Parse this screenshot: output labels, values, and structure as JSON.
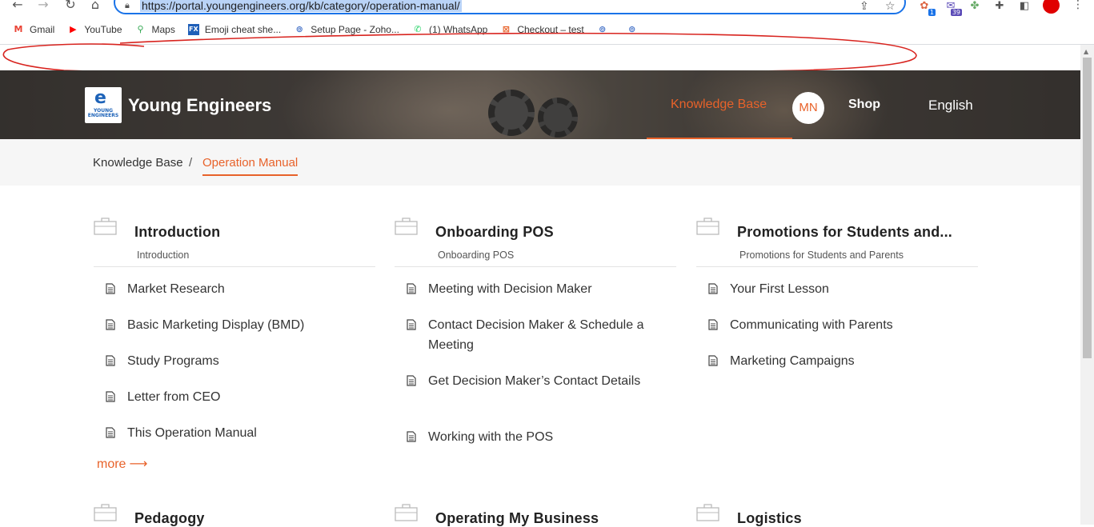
{
  "browser": {
    "url": "https://portal.youngengineers.org/kb/category/operation-manual/",
    "bookmarks": [
      {
        "label": "Gmail",
        "icon": "gmail-icon",
        "color": "#ea4335"
      },
      {
        "label": "YouTube",
        "icon": "youtube-icon",
        "color": "#ff0000"
      },
      {
        "label": "Maps",
        "icon": "maps-icon",
        "color": "#34a853"
      },
      {
        "label": "Emoji cheat she...",
        "icon": "fx-icon",
        "color": "#1f5fb8"
      },
      {
        "label": "Setup Page - Zoho...",
        "icon": "zoho-icon",
        "color": "#4a76c9"
      },
      {
        "label": "(1) WhatsApp",
        "icon": "whatsapp-icon",
        "color": "#25d366"
      },
      {
        "label": "Checkout – test",
        "icon": "checkout-icon",
        "color": "#e8622a"
      },
      {
        "label": "",
        "icon": "link-icon",
        "color": "#4a76c9"
      },
      {
        "label": "",
        "icon": "link-icon",
        "color": "#4a76c9"
      }
    ],
    "extension_badges": [
      "1",
      "39"
    ]
  },
  "header": {
    "brand": "Young Engineers",
    "logo_text": "YOUNG ENGINEERS",
    "nav": {
      "knowledge_base": "Knowledge Base",
      "user_initials": "MN",
      "shop": "Shop",
      "language": "English"
    },
    "accent_color": "#e8622a"
  },
  "breadcrumb": {
    "home": "Knowledge Base",
    "separator": "/",
    "current": "Operation Manual"
  },
  "categories": [
    {
      "title": "Introduction",
      "subtitle": "Introduction",
      "articles": [
        "Market Research",
        "Basic Marketing Display (BMD)",
        "Study Programs",
        "Letter from CEO",
        "This Operation Manual"
      ],
      "more": "more"
    },
    {
      "title": "Onboarding POS",
      "subtitle": "Onboarding POS",
      "articles": [
        "Meeting with Decision Maker",
        "Contact Decision Maker & Schedule a Meeting",
        "Get Decision Maker’s Contact Details",
        "Working with the POS"
      ]
    },
    {
      "title": "Promotions for Students and...",
      "subtitle": "Promotions for Students and Parents",
      "articles": [
        "Your First Lesson",
        "Communicating with Parents",
        "Marketing Campaigns"
      ]
    },
    {
      "title": "Pedagogy"
    },
    {
      "title": "Operating My Business"
    },
    {
      "title": "Logistics"
    }
  ]
}
